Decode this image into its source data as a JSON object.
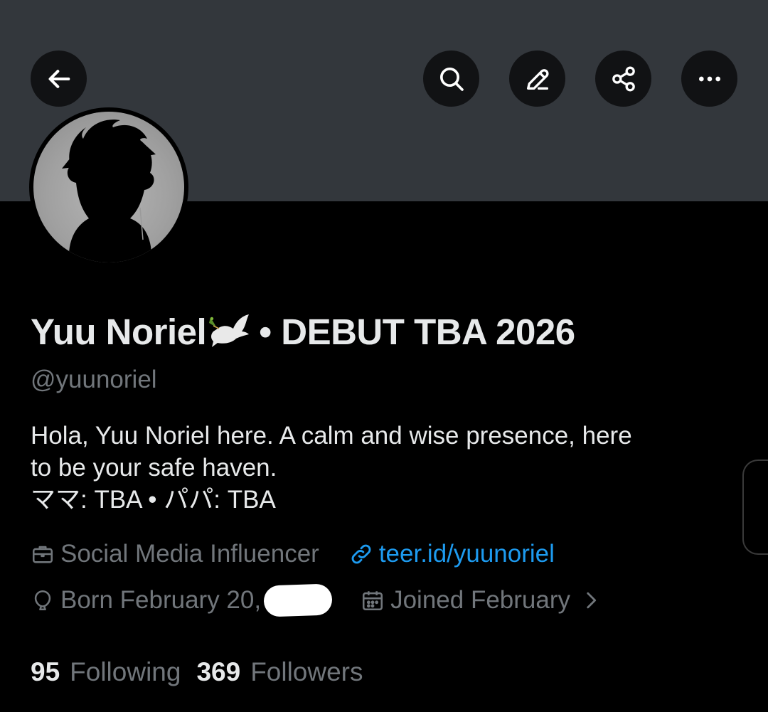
{
  "header": {
    "back_icon": "arrow-left-icon",
    "search_icon": "search-icon",
    "edit_icon": "pencil-icon",
    "share_icon": "share-icon",
    "more_icon": "more-horizontal-icon"
  },
  "profile": {
    "display_name_prefix": "Yuu Noriel",
    "display_name_emoji": "dove-icon",
    "display_name_suffix": "• DEBUT TBA 2026",
    "handle": "@yuunoriel",
    "bio_lines": [
      "Hola, Yuu Noriel here. A calm and wise presence, here",
      "to be your safe haven.",
      "ママ: TBA • パパ: TBA"
    ],
    "category": "Social Media Influencer",
    "website": "teer.id/yuunoriel",
    "birthday": "Born February 20,",
    "joined": "Joined February",
    "following_count": "95",
    "following_label": "Following",
    "followers_count": "369",
    "followers_label": "Followers"
  },
  "colors": {
    "banner": "#33373c",
    "background": "#000000",
    "text_primary": "#e7e9ea",
    "text_secondary": "#71767b",
    "link": "#1d9bf0"
  }
}
